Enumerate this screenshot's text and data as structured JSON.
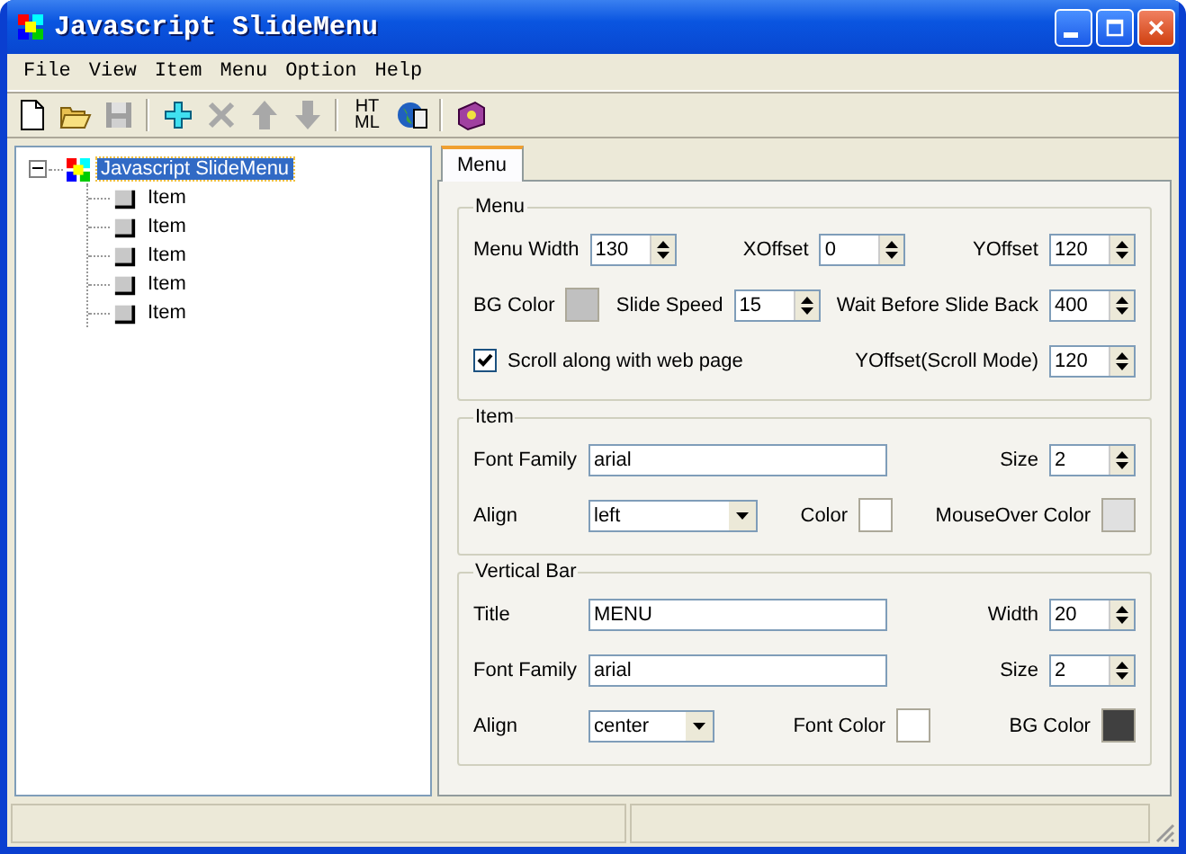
{
  "window": {
    "title": "Javascript SlideMenu"
  },
  "menu_bar": [
    "File",
    "View",
    "Item",
    "Menu",
    "Option",
    "Help"
  ],
  "toolbar": [
    {
      "kind": "new",
      "disabled": false
    },
    {
      "kind": "open",
      "disabled": false
    },
    {
      "kind": "save",
      "disabled": true
    },
    {
      "kind": "sep"
    },
    {
      "kind": "add",
      "disabled": false
    },
    {
      "kind": "delete",
      "disabled": true
    },
    {
      "kind": "up",
      "disabled": true
    },
    {
      "kind": "down",
      "disabled": true
    },
    {
      "kind": "sep"
    },
    {
      "kind": "html",
      "label": "HT ML",
      "disabled": false
    },
    {
      "kind": "preview",
      "disabled": false
    },
    {
      "kind": "sep"
    },
    {
      "kind": "help",
      "disabled": false
    }
  ],
  "tree": {
    "label": "Javascript SlideMenu",
    "selected": true,
    "expanded": true,
    "children": [
      {
        "label": "Item",
        "selected": false
      },
      {
        "label": "Item",
        "selected": false
      },
      {
        "label": "Item",
        "selected": false
      },
      {
        "label": "Item",
        "selected": false
      },
      {
        "label": "Item",
        "selected": false
      }
    ]
  },
  "tabs": [
    {
      "label": "Menu",
      "selected": true
    }
  ],
  "groups": [
    {
      "title": "Menu",
      "rows": [
        [
          {
            "kind": "spin",
            "label": "Menu Width",
            "value": "130"
          },
          {
            "kind": "spin",
            "label": "XOffset",
            "value": "0"
          },
          {
            "kind": "spin",
            "label": "YOffset",
            "value": "120"
          }
        ],
        [
          {
            "kind": "color",
            "label": "BG Color",
            "color": "#c0c0c0"
          },
          {
            "kind": "spin",
            "label": "Slide Speed",
            "value": "15"
          },
          {
            "kind": "spin",
            "label": "Wait Before Slide Back",
            "value": "400"
          }
        ],
        [
          {
            "kind": "checkbox",
            "label": "Scroll along with web page",
            "checked": true
          },
          {
            "kind": "blank"
          },
          {
            "kind": "spin",
            "label": "YOffset(Scroll Mode)",
            "value": "120"
          }
        ]
      ]
    },
    {
      "title": "Item",
      "rows": [
        [
          {
            "kind": "text",
            "label": "Font Family",
            "value": "arial"
          },
          {
            "kind": "blank"
          },
          {
            "kind": "spin",
            "label": "Size",
            "value": "2"
          }
        ],
        [
          {
            "kind": "select",
            "label": "Align",
            "value": "left"
          },
          {
            "kind": "color",
            "label": "Color",
            "color": "#ffffff"
          },
          {
            "kind": "color",
            "label": "MouseOver Color",
            "color": "#e0e0e0"
          }
        ]
      ]
    },
    {
      "title": "Vertical Bar",
      "rows": [
        [
          {
            "kind": "text",
            "label": "Title",
            "value": "MENU"
          },
          {
            "kind": "blank"
          },
          {
            "kind": "spin",
            "label": "Width",
            "value": "20"
          }
        ],
        [
          {
            "kind": "text",
            "label": "Font Family",
            "value": "arial"
          },
          {
            "kind": "blank"
          },
          {
            "kind": "spin",
            "label": "Size",
            "value": "2"
          }
        ],
        [
          {
            "kind": "select",
            "label": "Align",
            "value": "center"
          },
          {
            "kind": "color",
            "label": "Font Color",
            "color": "#ffffff"
          },
          {
            "kind": "color",
            "label": "BG Color",
            "color": "#404040"
          }
        ]
      ]
    }
  ]
}
